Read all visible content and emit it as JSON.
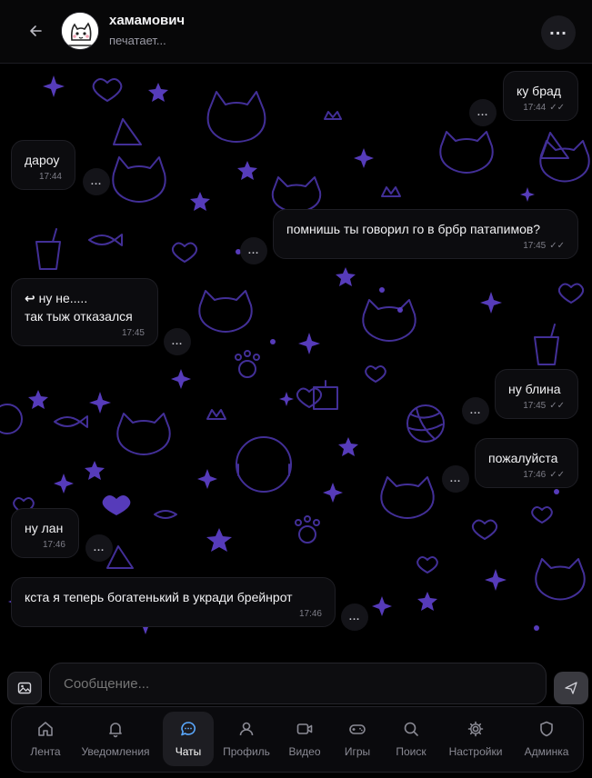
{
  "header": {
    "back_icon": "arrow-left-icon",
    "name": "хамамович",
    "status": "печатает...",
    "more_label": "..."
  },
  "messages": [
    {
      "side": "out",
      "text": "ку брад",
      "time": "17:44",
      "ticks": "✓✓"
    },
    {
      "side": "in",
      "text": "дароу",
      "time": "17:44"
    },
    {
      "side": "out",
      "text": "помнишь ты говорил го в брбр патапимов?",
      "time": "17:45",
      "ticks": "✓✓"
    },
    {
      "side": "in",
      "reply_mark": "↩",
      "line1": "ну не.....",
      "line2": "так тыж отказался",
      "time": "17:45"
    },
    {
      "side": "out",
      "text": "ну блина",
      "time": "17:45",
      "ticks": "✓✓"
    },
    {
      "side": "out",
      "text": "пожалуйста",
      "time": "17:46",
      "ticks": "✓✓"
    },
    {
      "side": "in",
      "text": "ну лан",
      "time": "17:46"
    },
    {
      "side": "in",
      "text": "кста я теперь богатенький в укради брейнрот",
      "time": "17:46"
    }
  ],
  "dots_label": "...",
  "composer": {
    "placeholder": "Сообщение..."
  },
  "nav": [
    {
      "label": "Лента",
      "icon": "home-icon"
    },
    {
      "label": "Уведомления",
      "icon": "bell-icon"
    },
    {
      "label": "Чаты",
      "icon": "chat-icon",
      "active": true
    },
    {
      "label": "Профиль",
      "icon": "user-icon"
    },
    {
      "label": "Видео",
      "icon": "video-icon"
    },
    {
      "label": "Игры",
      "icon": "gamepad-icon"
    },
    {
      "label": "Поиск",
      "icon": "search-icon"
    },
    {
      "label": "Настройки",
      "icon": "gear-icon"
    },
    {
      "label": "Админка",
      "icon": "shield-icon"
    }
  ],
  "colors": {
    "accent": "#5aa9ff",
    "doodle": "#5b3fc4",
    "bubble_bg": "#0c0c0f"
  }
}
